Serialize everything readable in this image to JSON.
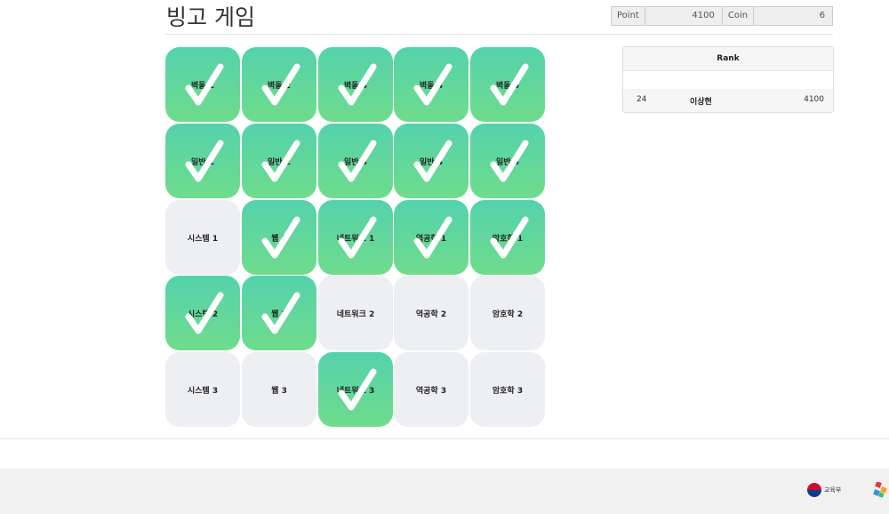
{
  "header": {
    "title": "빙고 게임",
    "point_label": "Point",
    "point_value": "4100",
    "coin_label": "Coin",
    "coin_value": "6"
  },
  "board": {
    "cells": [
      {
        "label": "벽돌 1",
        "done": true
      },
      {
        "label": "벽돌 2",
        "done": true
      },
      {
        "label": "벽돌 3",
        "done": true
      },
      {
        "label": "벽돌 4",
        "done": true
      },
      {
        "label": "벽돌 5",
        "done": true
      },
      {
        "label": "일반 1",
        "done": true
      },
      {
        "label": "일반 2",
        "done": true
      },
      {
        "label": "일반 3",
        "done": true
      },
      {
        "label": "일반 4",
        "done": true
      },
      {
        "label": "일반 5",
        "done": true
      },
      {
        "label": "시스템 1",
        "done": false
      },
      {
        "label": "웹 1",
        "done": true
      },
      {
        "label": "네트워크 1",
        "done": true
      },
      {
        "label": "역공학 1",
        "done": true
      },
      {
        "label": "암호학 1",
        "done": true
      },
      {
        "label": "시스템 2",
        "done": true
      },
      {
        "label": "웹 2",
        "done": true
      },
      {
        "label": "네트워크 2",
        "done": false
      },
      {
        "label": "역공학 2",
        "done": false
      },
      {
        "label": "암호학 2",
        "done": false
      },
      {
        "label": "시스템 3",
        "done": false
      },
      {
        "label": "웹 3",
        "done": false
      },
      {
        "label": "네트워크 3",
        "done": true
      },
      {
        "label": "역공학 3",
        "done": false
      },
      {
        "label": "암호학 3",
        "done": false
      }
    ]
  },
  "rank": {
    "title": "Rank",
    "entries": [
      {
        "rank": "24",
        "name": "이상현",
        "points": "4100"
      }
    ]
  },
  "footer": {
    "moe_text": "교육부"
  },
  "colors": {
    "done_top": "#55d2ac",
    "done_bottom": "#6fdc8c",
    "pending": "#eeeff2"
  }
}
